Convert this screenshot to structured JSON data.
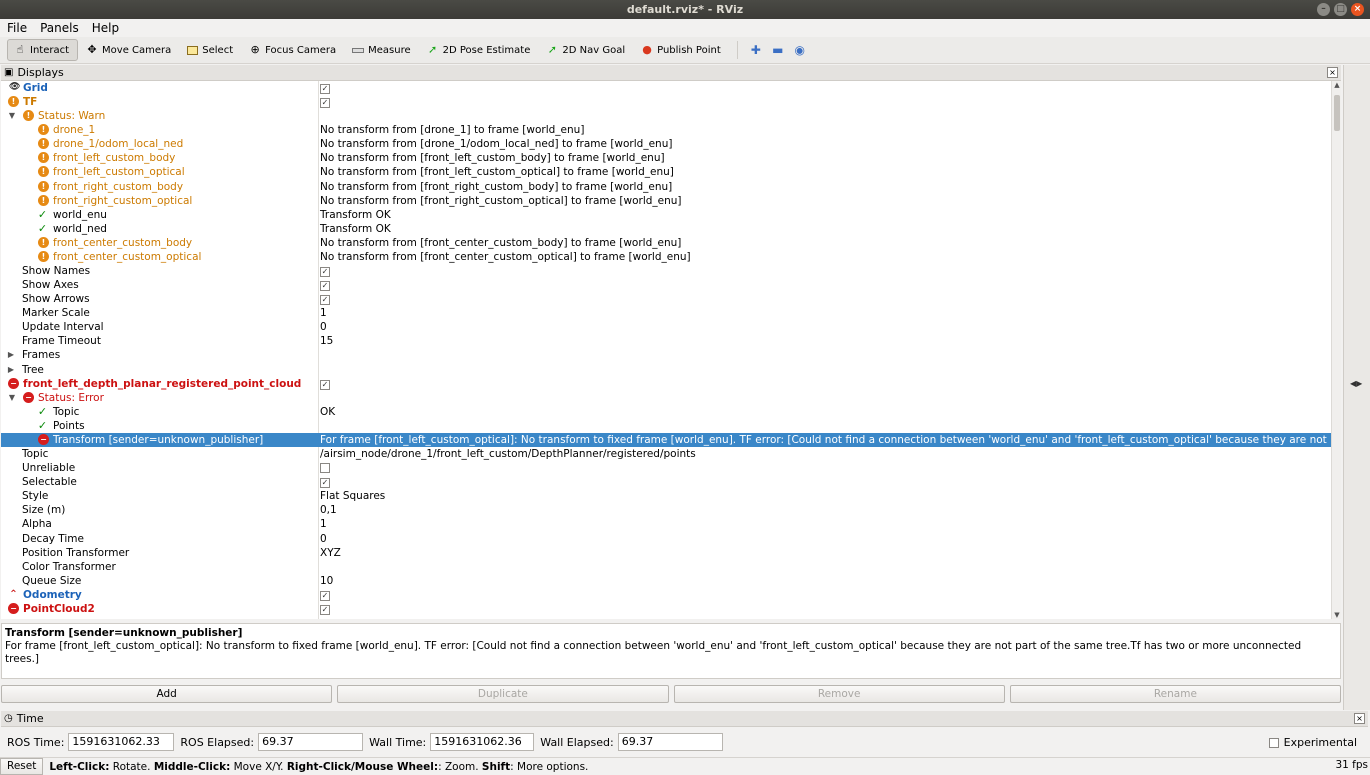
{
  "window": {
    "title": "default.rviz* - RViz"
  },
  "menu": [
    "File",
    "Panels",
    "Help"
  ],
  "toolbar": {
    "tools": [
      {
        "label": "Interact",
        "icon": "hand-icon",
        "active": true
      },
      {
        "label": "Move Camera",
        "icon": "move-camera-icon",
        "active": false
      },
      {
        "label": "Select",
        "icon": "select-icon",
        "active": false
      },
      {
        "label": "Focus Camera",
        "icon": "focus-camera-icon",
        "active": false
      },
      {
        "label": "Measure",
        "icon": "ruler-icon",
        "active": false
      },
      {
        "label": "2D Pose Estimate",
        "icon": "green-arrow-icon",
        "active": false
      },
      {
        "label": "2D Nav Goal",
        "icon": "green-arrow-icon",
        "active": false
      },
      {
        "label": "Publish Point",
        "icon": "map-pin-icon",
        "active": false
      }
    ]
  },
  "displays": {
    "title": "Displays",
    "rows": [
      {
        "name": "Grid",
        "value": "",
        "check": true
      },
      {
        "name": "TF",
        "value": "",
        "check": true
      },
      {
        "name": "Status: Warn",
        "value": ""
      },
      {
        "name": "drone_1",
        "value": "No transform from [drone_1] to frame [world_enu]"
      },
      {
        "name": "drone_1/odom_local_ned",
        "value": "No transform from [drone_1/odom_local_ned] to frame [world_enu]"
      },
      {
        "name": "front_left_custom_body",
        "value": "No transform from [front_left_custom_body] to frame [world_enu]"
      },
      {
        "name": "front_left_custom_optical",
        "value": "No transform from [front_left_custom_optical] to frame [world_enu]"
      },
      {
        "name": "front_right_custom_body",
        "value": "No transform from [front_right_custom_body] to frame [world_enu]"
      },
      {
        "name": "front_right_custom_optical",
        "value": "No transform from [front_right_custom_optical] to frame [world_enu]"
      },
      {
        "name": "world_enu",
        "value": "Transform OK"
      },
      {
        "name": "world_ned",
        "value": "Transform OK"
      },
      {
        "name": "front_center_custom_body",
        "value": "No transform from [front_center_custom_body] to frame [world_enu]"
      },
      {
        "name": "front_center_custom_optical",
        "value": "No transform from [front_center_custom_optical] to frame [world_enu]"
      },
      {
        "name": "Show Names",
        "value": "",
        "check": true
      },
      {
        "name": "Show Axes",
        "value": "",
        "check": true
      },
      {
        "name": "Show Arrows",
        "value": "",
        "check": true
      },
      {
        "name": "Marker Scale",
        "value": "1"
      },
      {
        "name": "Update Interval",
        "value": "0"
      },
      {
        "name": "Frame Timeout",
        "value": "15"
      },
      {
        "name": "Frames",
        "value": ""
      },
      {
        "name": "Tree",
        "value": ""
      },
      {
        "name": "front_left_depth_planar_registered_point_cloud",
        "value": "",
        "check": true
      },
      {
        "name": "Status: Error",
        "value": ""
      },
      {
        "name": "Topic",
        "value": "OK"
      },
      {
        "name": "Points",
        "value": ""
      },
      {
        "name": "Transform [sender=unknown_publisher]",
        "value": "For frame [front_left_custom_optical]: No transform to fixed frame [world_enu].  TF error: [Could not find a connection between 'world_enu' and 'front_left_custom_optical' because they are not part ..."
      },
      {
        "name": "Topic",
        "value": "/airsim_node/drone_1/front_left_custom/DepthPlanner/registered/points"
      },
      {
        "name": "Unreliable",
        "value": "",
        "check": false
      },
      {
        "name": "Selectable",
        "value": "",
        "check": true
      },
      {
        "name": "Style",
        "value": "Flat Squares"
      },
      {
        "name": "Size (m)",
        "value": "0,1"
      },
      {
        "name": "Alpha",
        "value": "1"
      },
      {
        "name": "Decay Time",
        "value": "0"
      },
      {
        "name": "Position Transformer",
        "value": "XYZ"
      },
      {
        "name": "Color Transformer",
        "value": ""
      },
      {
        "name": "Queue Size",
        "value": "10"
      },
      {
        "name": "Odometry",
        "value": "",
        "check": true
      },
      {
        "name": "PointCloud2",
        "value": "",
        "check": true
      }
    ]
  },
  "description": {
    "title": "Transform [sender=unknown_publisher]",
    "body": "For frame [front_left_custom_optical]: No transform to fixed frame [world_enu]. TF error: [Could not find a connection between 'world_enu' and 'front_left_custom_optical' because they are not part of the same tree.Tf has two or more unconnected trees.]"
  },
  "buttons": {
    "add": "Add",
    "duplicate": "Duplicate",
    "remove": "Remove",
    "rename": "Rename"
  },
  "time": {
    "title": "Time",
    "ros_time_label": "ROS Time:",
    "ros_time": "1591631062.33",
    "ros_elapsed_label": "ROS Elapsed:",
    "ros_elapsed": "69.37",
    "wall_time_label": "Wall Time:",
    "wall_time": "1591631062.36",
    "wall_elapsed_label": "Wall Elapsed:",
    "wall_elapsed": "69.37",
    "experimental": "Experimental"
  },
  "status": {
    "reset": "Reset",
    "left_click": "Left-Click:",
    "left_click_desc": " Rotate. ",
    "middle_click": "Middle-Click:",
    "middle_click_desc": " Move X/Y. ",
    "right_click": "Right-Click/Mouse Wheel:",
    "right_click_desc": ": Zoom. ",
    "shift": "Shift",
    "shift_desc": ": More options.",
    "fps": "31 fps"
  },
  "colors": {
    "selection": "#3a87c8",
    "warn": "#e68a14",
    "error": "#d51d1d",
    "ok": "#0a8a0a"
  }
}
